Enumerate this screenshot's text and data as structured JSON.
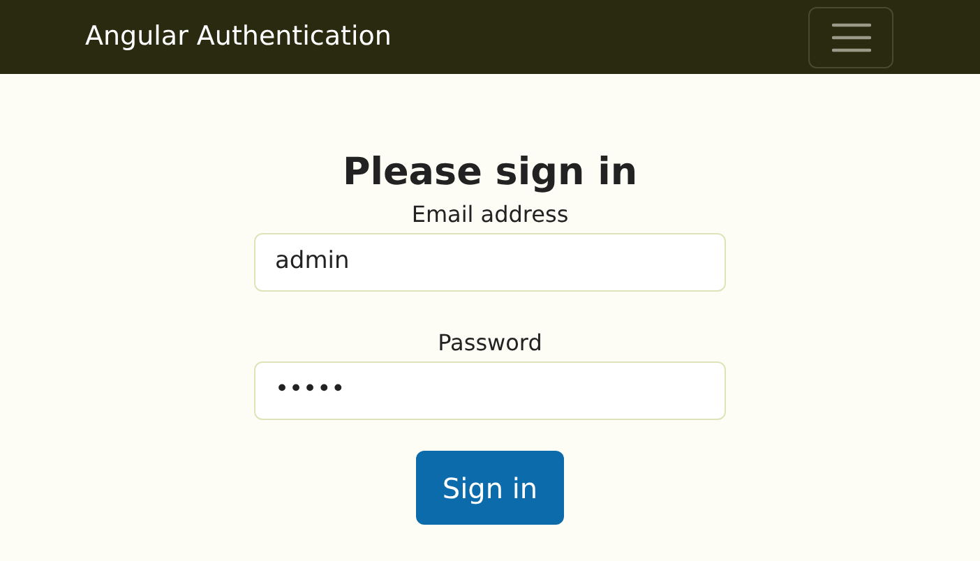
{
  "navbar": {
    "brand": "Angular Authentication"
  },
  "form": {
    "heading": "Please sign in",
    "fields": [
      {
        "label": "Email address",
        "value": "admin"
      },
      {
        "label": "Password",
        "value": "•••••"
      }
    ],
    "button": "Sign in"
  }
}
